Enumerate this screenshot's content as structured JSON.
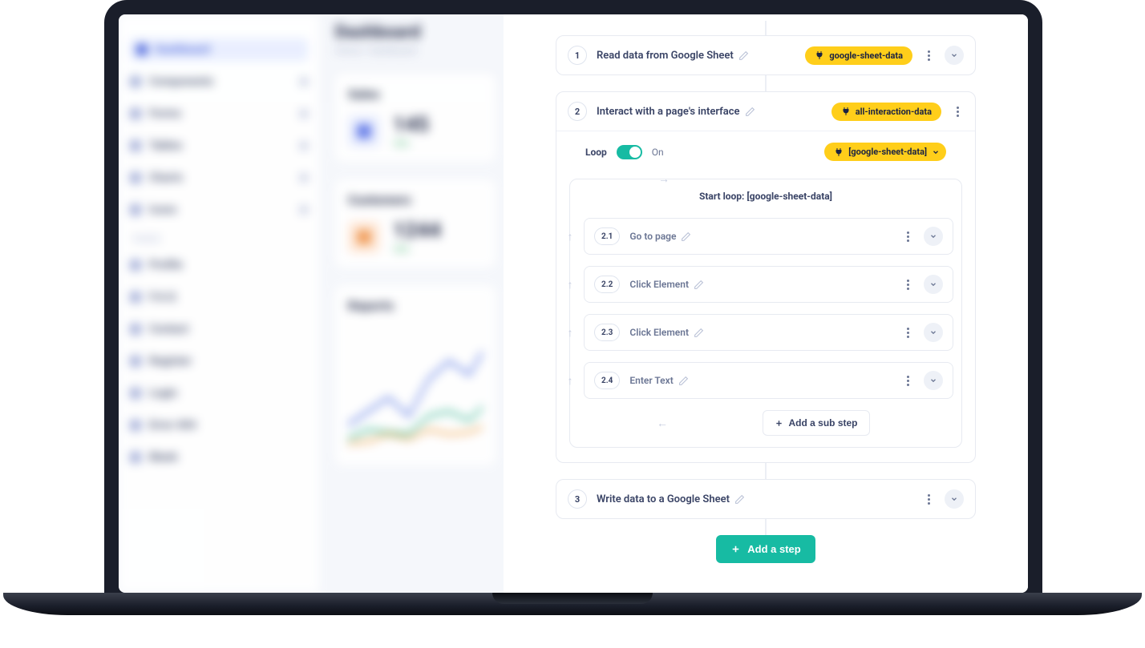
{
  "bg": {
    "sidebar": {
      "items": [
        {
          "label": "Dashboard",
          "active": true
        },
        {
          "label": "Components"
        },
        {
          "label": "Forms"
        },
        {
          "label": "Tables"
        },
        {
          "label": "Charts"
        },
        {
          "label": "Icons"
        }
      ],
      "section_label": "PAGES",
      "pages": [
        {
          "label": "Profile"
        },
        {
          "label": "F.A.Q"
        },
        {
          "label": "Contact"
        },
        {
          "label": "Register"
        },
        {
          "label": "Login"
        },
        {
          "label": "Error 404"
        },
        {
          "label": "Blank"
        }
      ]
    },
    "main": {
      "title": "Dashboard",
      "crumb": "Home / Dashboard",
      "card_sales": {
        "title": "Sales",
        "value": "145",
        "delta": "12%"
      },
      "card_customers": {
        "title": "Customers",
        "value": "1244",
        "delta": "12%"
      },
      "card_reports": {
        "title": "Reports"
      }
    }
  },
  "workflow": {
    "steps": {
      "s1": {
        "num": "1",
        "title": "Read data from Google Sheet",
        "tag": "google-sheet-data"
      },
      "s2": {
        "num": "2",
        "title": "Interact with a page's interface",
        "tag": "all-interaction-data",
        "loop": {
          "label": "Loop",
          "state_label": "On",
          "source": "[google-sheet-data]",
          "frame_title": "Start loop: [google-sheet-data]",
          "subs": {
            "a": {
              "num": "2.1",
              "title": "Go to page"
            },
            "b": {
              "num": "2.2",
              "title": "Click Element"
            },
            "c": {
              "num": "2.3",
              "title": "Click Element"
            },
            "d": {
              "num": "2.4",
              "title": "Enter Text"
            }
          },
          "add_sub_label": "Add a sub step"
        }
      },
      "s3": {
        "num": "3",
        "title": "Write data to a Google Sheet"
      }
    },
    "add_step_label": "Add a step"
  }
}
